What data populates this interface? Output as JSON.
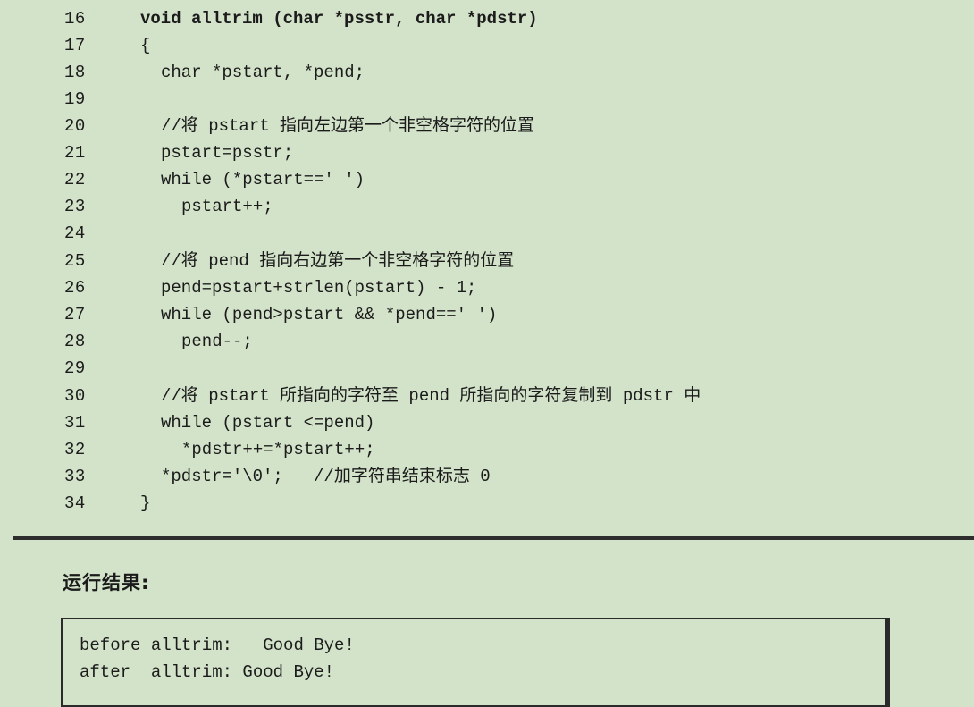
{
  "code": {
    "lines": [
      {
        "no": "16",
        "text": "void alltrim (char *psstr, char *pdstr)"
      },
      {
        "no": "17",
        "text": "{"
      },
      {
        "no": "18",
        "text": "char *pstart, *pend;"
      },
      {
        "no": "19",
        "text": ""
      },
      {
        "no": "20",
        "text": "//将 pstart 指向左边第一个非空格字符的位置"
      },
      {
        "no": "21",
        "text": "pstart=psstr;"
      },
      {
        "no": "22",
        "text": "while (*pstart==' ')"
      },
      {
        "no": "23",
        "text": "pstart++;"
      },
      {
        "no": "24",
        "text": ""
      },
      {
        "no": "25",
        "text": "//将 pend 指向右边第一个非空格字符的位置"
      },
      {
        "no": "26",
        "text": "pend=pstart+strlen(pstart) - 1;"
      },
      {
        "no": "27",
        "text": "while (pend>pstart && *pend==' ')"
      },
      {
        "no": "28",
        "text": "pend--;"
      },
      {
        "no": "29",
        "text": ""
      },
      {
        "no": "30",
        "text": "//将 pstart 所指向的字符至 pend 所指向的字符复制到 pdstr 中"
      },
      {
        "no": "31",
        "text": "while (pstart <=pend)"
      },
      {
        "no": "32",
        "text": "*pdstr++=*pstart++;"
      },
      {
        "no": "33",
        "text": "*pdstr='\\0';   //加字符串结束标志 0"
      },
      {
        "no": "34",
        "text": "}"
      }
    ]
  },
  "result": {
    "heading": "运行结果:",
    "output": [
      "before alltrim:   Good Bye!",
      "after  alltrim: Good Bye!"
    ]
  }
}
